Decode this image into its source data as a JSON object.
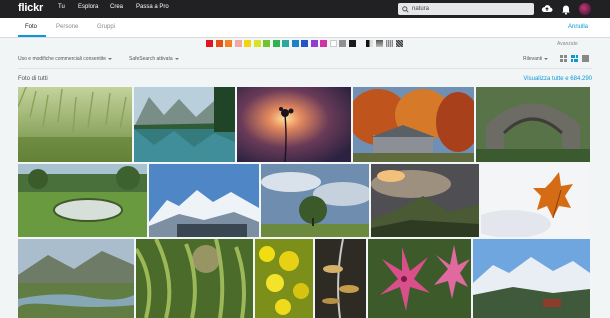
{
  "header": {
    "logo": "flickr",
    "nav": [
      "Tu",
      "Esplora",
      "Crea",
      "Passa a Pro"
    ],
    "search_value": "natura"
  },
  "tabs": [
    "Foto",
    "Persone",
    "Gruppi"
  ],
  "active_tab": "Foto",
  "cancel_label": "Annulla",
  "color_filters": [
    "#e3141b",
    "#e84d12",
    "#f08124",
    "#f5a6a4",
    "#f4d40f",
    "#d5e32a",
    "#6fc52e",
    "#30b34f",
    "#2aaa9e",
    "#1c81ca",
    "#2751c6",
    "#8f3ccf",
    "#d431a3",
    "#fdfdfd",
    "#909090",
    "#1b1b1b"
  ],
  "advanced_label": "Avanzate",
  "options": {
    "license": "Uso e modifiche commerciali consentite",
    "safesearch": "SafeSearch attivata",
    "sort": "Rilevanti"
  },
  "results": {
    "title": "Foto di tutti",
    "view_all": "Visualizza tutte e 684.290"
  },
  "photos": [
    "grass-field",
    "mountain-lake",
    "flower-sunset",
    "autumn-trees",
    "stone-bridge",
    "pond-meadow",
    "snowy-mountains",
    "lone-tree",
    "valley-clouds",
    "autumn-leaf-snow",
    "river-valley",
    "green-vegetation",
    "yellow-flowers",
    "plant-closeup",
    "pink-lilies",
    "winter-mountains"
  ]
}
